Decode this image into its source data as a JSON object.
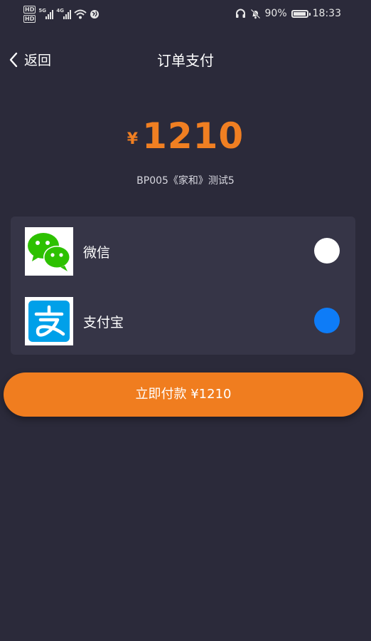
{
  "status_bar": {
    "hd1": "HD",
    "hd2": "HD",
    "net1": "5G",
    "net2": "4G",
    "battery": "90%",
    "time": "18:33"
  },
  "nav": {
    "back_label": "返回",
    "title": "订单支付"
  },
  "amount": {
    "currency": "¥",
    "value": "1210"
  },
  "order_desc": "BP005《家和》测试5",
  "payment_methods": [
    {
      "label": "微信",
      "selected": false,
      "icon": "wechat-icon"
    },
    {
      "label": "支付宝",
      "selected": true,
      "icon": "alipay-icon"
    }
  ],
  "pay_button": {
    "label": "立即付款 ¥1210"
  },
  "colors": {
    "background": "#2b2a3a",
    "card": "#363547",
    "accent": "#f07d1f",
    "radio_selected": "#0e7cf7"
  }
}
